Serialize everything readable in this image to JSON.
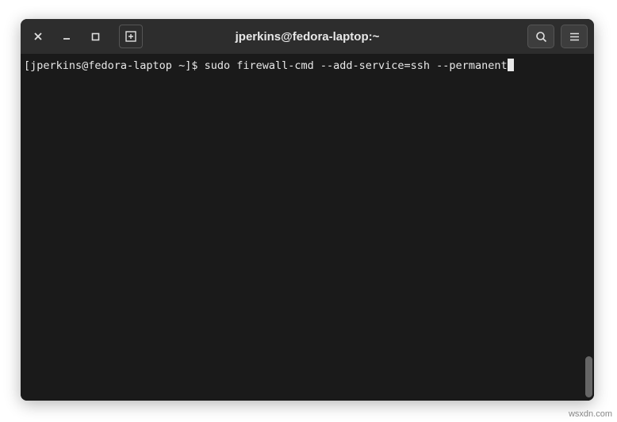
{
  "window": {
    "title": "jperkins@fedora-laptop:~"
  },
  "terminal": {
    "prompt": "[jperkins@fedora-laptop ~]$ ",
    "command": "sudo firewall-cmd --add-service=ssh --permanent"
  },
  "watermark": "wsxdn.com"
}
